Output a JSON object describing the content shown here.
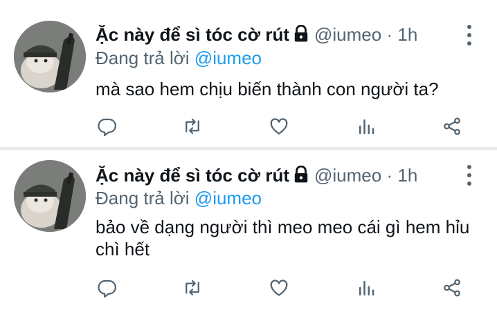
{
  "accent_color": "#1d9bf0",
  "tweets": [
    {
      "display_name": "Ặc này để sì tóc cờ rút",
      "handle": "@iumeo",
      "separator": "·",
      "time": "1h",
      "reply_prefix": "Đang trả lời",
      "reply_mention": "@iumeo",
      "text": "mà sao hem chịu biến thành con người ta?",
      "icons": [
        "lock-icon",
        "more-icon",
        "reply-icon",
        "retweet-icon",
        "like-icon",
        "analytics-icon",
        "share-icon"
      ]
    },
    {
      "display_name": "Ặc này để sì tóc cờ rút",
      "handle": "@iumeo",
      "separator": "·",
      "time": "1h",
      "reply_prefix": "Đang trả lời",
      "reply_mention": "@iumeo",
      "text": "bảo về dạng người thì meo meo cái gì hem hỉu chì hết",
      "icons": [
        "lock-icon",
        "more-icon",
        "reply-icon",
        "retweet-icon",
        "like-icon",
        "analytics-icon",
        "share-icon"
      ]
    }
  ]
}
